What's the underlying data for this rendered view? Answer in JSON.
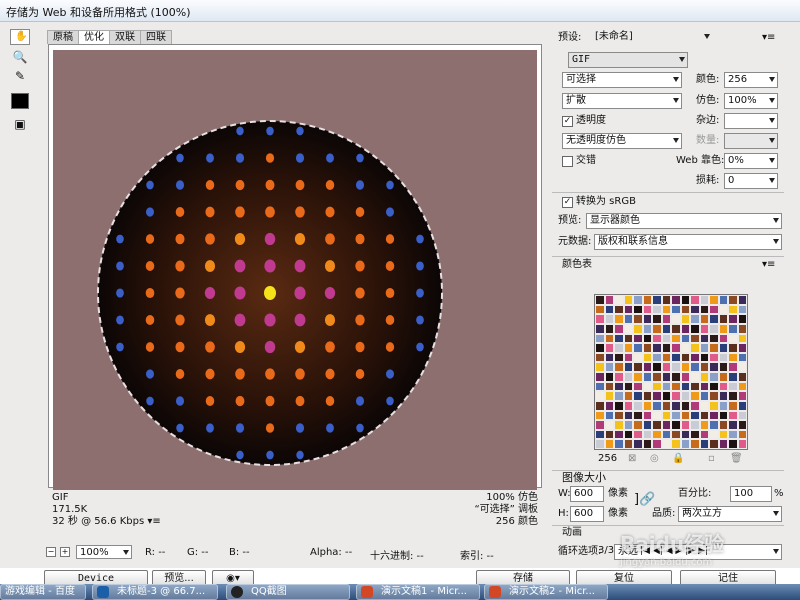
{
  "window": {
    "title": "存储为 Web 和设备所用格式 (100%)"
  },
  "tabs": [
    "原稿",
    "优化",
    "双联",
    "四联"
  ],
  "info_left": {
    "format": "GIF",
    "size": "171.5K",
    "time": "32 秒 @ 56.6 Kbps"
  },
  "info_right": {
    "dither": "100% 仿色",
    "palette": "“可选择” 调板",
    "colors": "256 颜色"
  },
  "status": {
    "zoom": "100%",
    "r": "R: --",
    "g": "G: --",
    "b": "B: --",
    "alpha": "Alpha: --",
    "hex": "十六进制: --",
    "index": "索引: --"
  },
  "preset": {
    "label": "预设:",
    "value": "[未命名]"
  },
  "format": "GIF",
  "reduction": "可选择",
  "dither_algo": "扩散",
  "transparency": {
    "label": "透明度",
    "checked": "✓"
  },
  "transparency_dither": "无透明度仿色",
  "interlace": {
    "label": "交错"
  },
  "colors_label": "颜色:",
  "colors_value": "256",
  "dither_label": "仿色:",
  "dither_value": "100%",
  "matte_label": "杂边:",
  "amount_label": "数量:",
  "web_snap_label": "Web 靠色:",
  "web_snap_value": "0%",
  "lossy_label": "损耗:",
  "lossy_value": "0",
  "srgb": {
    "label": "转换为 sRGB",
    "checked": "✓"
  },
  "preview": {
    "label": "预览:",
    "value": "显示器颜色"
  },
  "metadata": {
    "label": "元数据:",
    "value": "版权和联系信息"
  },
  "color_table": {
    "label": "颜色表",
    "count": "256"
  },
  "image_size": {
    "label": "图像大小",
    "w_label": "W:",
    "w": "600",
    "h_label": "H:",
    "h": "600",
    "unit": "像素",
    "percent_label": "百分比:",
    "percent": "100",
    "pct": "%",
    "quality_label": "品质:",
    "quality": "两次立方"
  },
  "animation": {
    "label": "动画",
    "loop_label": "循环选项:",
    "loop": "永远",
    "frame": "3/3"
  },
  "buttons": {
    "device_central": "Device Central...",
    "preview": "预览...",
    "save": "存储",
    "reset": "复位",
    "remember": "记住"
  },
  "taskbar": [
    "游戏编辑 - 百度",
    "未标题-3 @ 66.7...",
    "QQ截图",
    "演示文稿1 - Micr...",
    "演示文稿2 - Micr..."
  ],
  "watermark": "Baidu经验",
  "watermark_url": "jingyan.baidu.com",
  "palette_colors": [
    "#2b1a17",
    "#5a2f1e",
    "#8b4a21",
    "#c66a1c",
    "#f09a1a",
    "#f4c21a",
    "#e05a8a",
    "#b13a78",
    "#6d2560",
    "#3a2a5a",
    "#2a3e7a",
    "#4e6fb0",
    "#8aa0c8",
    "#c9ccd4",
    "#f2eee6",
    "#1a1110"
  ]
}
